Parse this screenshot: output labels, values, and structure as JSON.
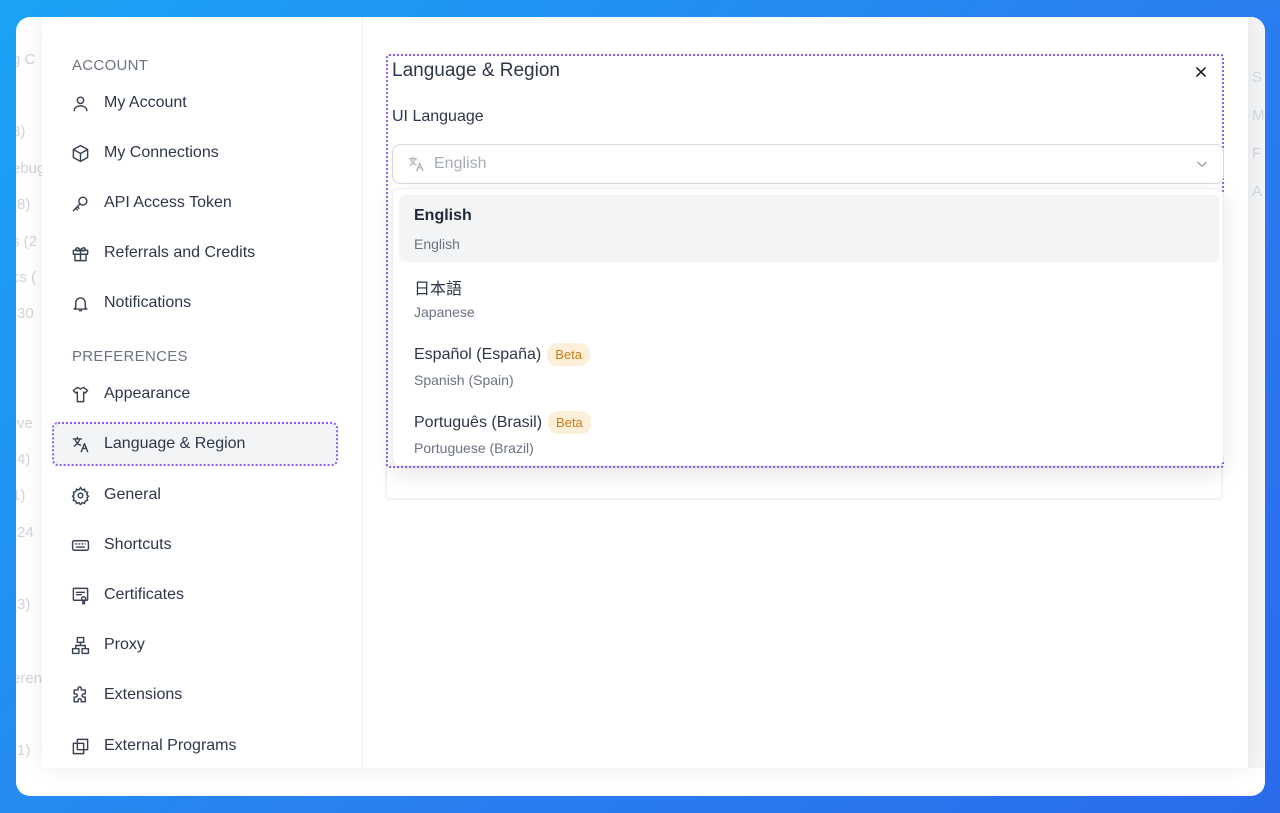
{
  "background_fragments": {
    "left": [
      "g C",
      ")",
      "3)",
      "ebug",
      "(8)",
      "s (2",
      "cs (",
      "(30",
      "rve",
      "(4)",
      "1)",
      "(24",
      "(3)",
      "eren",
      "(1)"
    ],
    "right": [
      "S",
      "M",
      "F",
      "A"
    ]
  },
  "sidebar": {
    "account_title": "ACCOUNT",
    "preferences_title": "PREFERENCES",
    "account_items": [
      {
        "label": "My Account",
        "icon": "user-icon"
      },
      {
        "label": "My Connections",
        "icon": "cube-icon"
      },
      {
        "label": "API Access Token",
        "icon": "key-icon"
      },
      {
        "label": "Referrals and Credits",
        "icon": "gift-icon"
      },
      {
        "label": "Notifications",
        "icon": "bell-icon"
      }
    ],
    "preference_items": [
      {
        "label": "Appearance",
        "icon": "shirt-icon"
      },
      {
        "label": "Language & Region",
        "icon": "translate-icon",
        "active": true
      },
      {
        "label": "General",
        "icon": "gear-icon"
      },
      {
        "label": "Shortcuts",
        "icon": "keyboard-icon"
      },
      {
        "label": "Certificates",
        "icon": "certificate-icon"
      },
      {
        "label": "Proxy",
        "icon": "network-icon"
      },
      {
        "label": "Extensions",
        "icon": "puzzle-icon"
      },
      {
        "label": "External Programs",
        "icon": "copy-icon"
      }
    ]
  },
  "panel": {
    "title": "Language & Region",
    "field_label": "UI Language",
    "select_value": "English",
    "options": [
      {
        "name": "English",
        "sub": "English",
        "selected": true,
        "badge": ""
      },
      {
        "name": "日本語",
        "sub": "Japanese",
        "selected": false,
        "badge": ""
      },
      {
        "name": "Español (España)",
        "sub": "Spanish (Spain)",
        "selected": false,
        "badge": "Beta"
      },
      {
        "name": "Português (Brasil)",
        "sub": "Portuguese (Brazil)",
        "selected": false,
        "badge": "Beta"
      }
    ]
  },
  "colors": {
    "accent_dotted": "#8b5cf6",
    "badge_bg": "#fdf0db",
    "badge_text": "#c77c16",
    "frame_gradient_start": "#1aa3f5",
    "frame_gradient_end": "#2a6cec"
  }
}
